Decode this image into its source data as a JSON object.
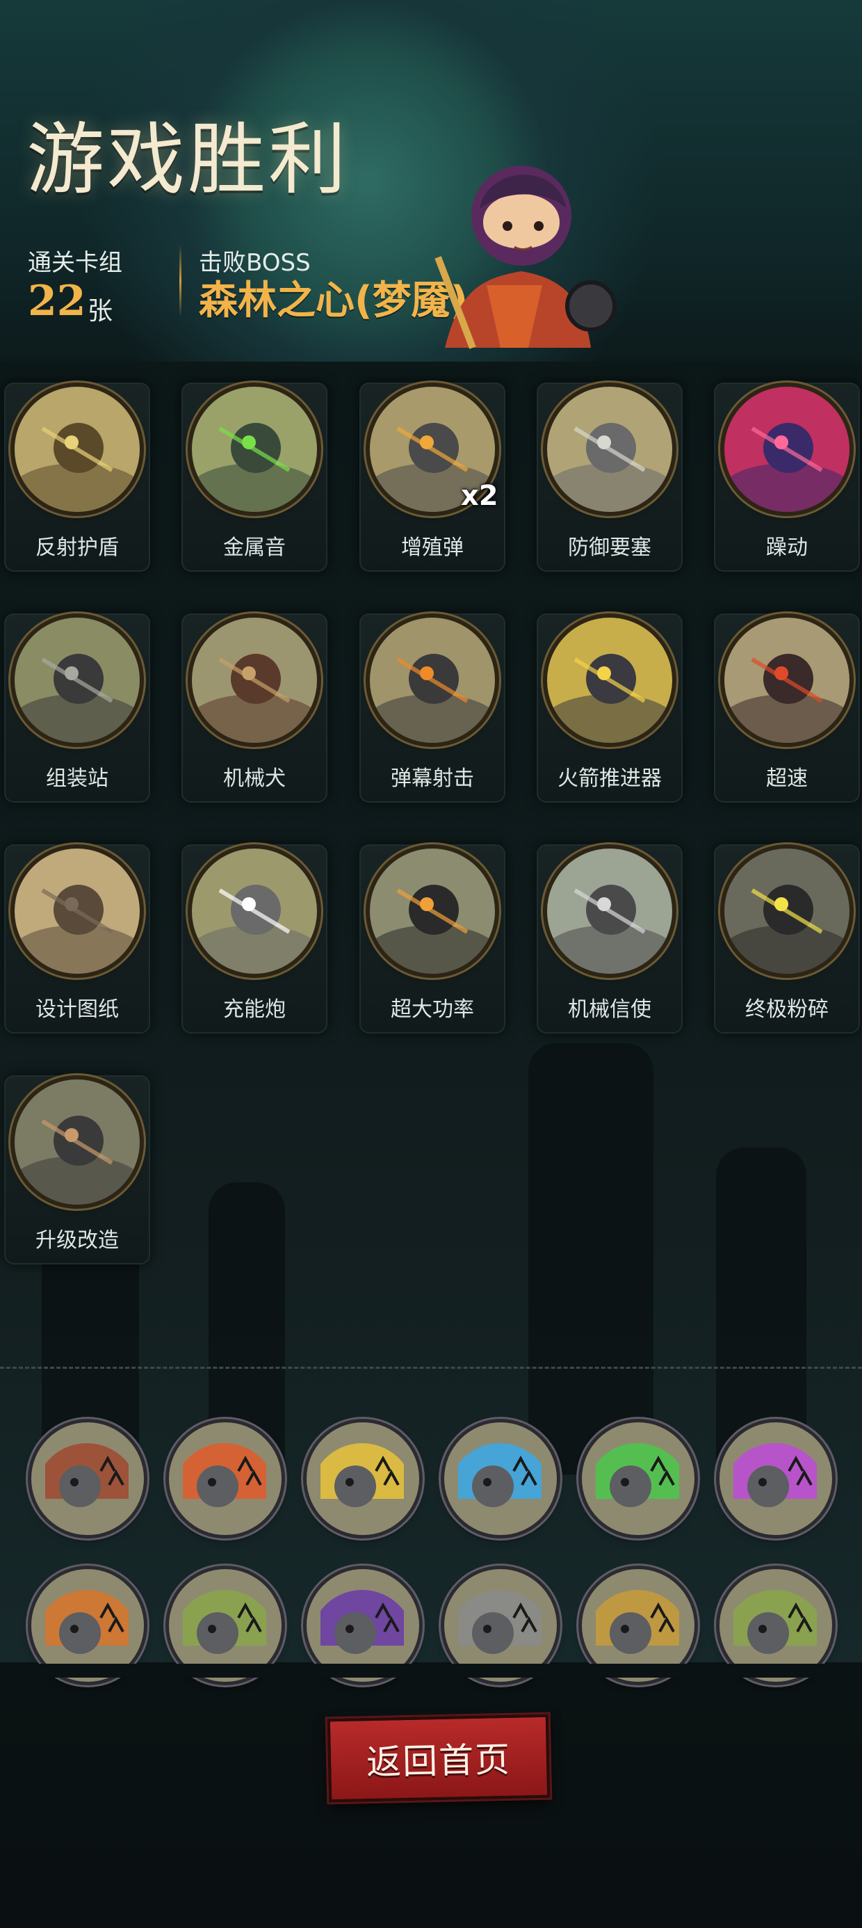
{
  "header": {
    "title": "游戏胜利",
    "deck_label": "通关卡组",
    "deck_count": "22",
    "deck_unit": "张",
    "boss_label": "击败BOSS",
    "boss_name": "森林之心(梦魇)"
  },
  "cards": [
    {
      "name": "反射护盾",
      "icon": "shield-reflect-icon"
    },
    {
      "name": "金属音",
      "icon": "metal-horn-icon"
    },
    {
      "name": "增殖弹",
      "icon": "bomb-multiply-icon",
      "multiplier": "x2"
    },
    {
      "name": "防御要塞",
      "icon": "fortress-icon"
    },
    {
      "name": "躁动",
      "icon": "frenzy-icon"
    },
    {
      "name": "组装站",
      "icon": "assembly-station-icon"
    },
    {
      "name": "机械犬",
      "icon": "mech-dog-icon"
    },
    {
      "name": "弹幕射击",
      "icon": "barrage-icon"
    },
    {
      "name": "火箭推进器",
      "icon": "rocket-booster-icon"
    },
    {
      "name": "超速",
      "icon": "overspeed-icon"
    },
    {
      "name": "设计图纸",
      "icon": "blueprint-icon"
    },
    {
      "name": "充能炮",
      "icon": "charge-cannon-icon"
    },
    {
      "name": "超大功率",
      "icon": "overpower-icon"
    },
    {
      "name": "机械信使",
      "icon": "mech-messenger-icon"
    },
    {
      "name": "终极粉碎",
      "icon": "ultimate-crush-icon"
    },
    {
      "name": "升级改造",
      "icon": "upgrade-icon"
    }
  ],
  "relics_row1": [
    {
      "icon": "skull-card-icon",
      "color": "#a0492f"
    },
    {
      "icon": "music-ghost-red-icon",
      "color": "#e05a2a"
    },
    {
      "icon": "music-ghost-yellow-icon",
      "color": "#e8c23a"
    },
    {
      "icon": "music-ghost-blue-icon",
      "color": "#3aa8e8"
    },
    {
      "icon": "music-ghost-green-icon",
      "color": "#4ac84a"
    },
    {
      "icon": "music-ghost-purple-icon",
      "color": "#c04ad8"
    }
  ],
  "relics_row2": [
    {
      "icon": "spark-blade-icon",
      "color": "#d8742a"
    },
    {
      "icon": "ogre-ghost-icon",
      "color": "#8aa64a"
    },
    {
      "icon": "void-orb-icon",
      "color": "#6a3aa8"
    },
    {
      "icon": "robot-guitar-icon",
      "color": "#8a8a8a"
    },
    {
      "icon": "golden-mech-icon",
      "color": "#c89a3a"
    },
    {
      "icon": "ogre-ghost-2-icon",
      "color": "#8aa64a"
    }
  ],
  "footer": {
    "home_button": "返回首页"
  },
  "colors": {
    "accent_gold": "#f2b44a",
    "button_red": "#a82020"
  }
}
